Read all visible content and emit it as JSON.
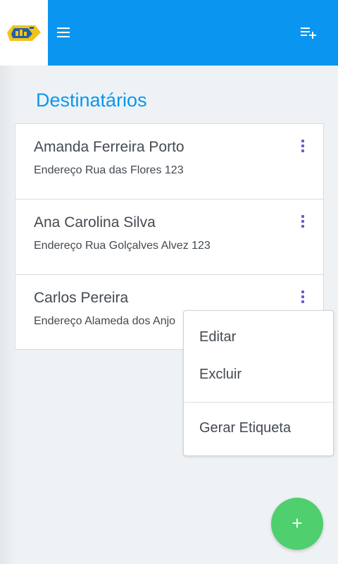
{
  "header": {
    "logo_icon": "company-logo-icon",
    "menu_icon": "hamburger-menu-icon",
    "action_icon": "playlist-add-icon",
    "background_color": "#0a96f0"
  },
  "page": {
    "title": "Destinatários"
  },
  "recipients": [
    {
      "name": "Amanda Ferreira Porto",
      "address_label": "Endereço",
      "address": "Rua das Flores 123"
    },
    {
      "name": "Ana Carolina Silva",
      "address_label": "Endereço",
      "address": "Rua Golçalves Alvez 123"
    },
    {
      "name": "Carlos Pereira",
      "address_label": "Endereço",
      "address": "Alameda dos Anjo"
    }
  ],
  "context_menu": {
    "items": [
      "Editar",
      "Excluir",
      "Gerar Etiqueta"
    ]
  },
  "fab": {
    "label": "+",
    "color": "#4fcf6d"
  }
}
